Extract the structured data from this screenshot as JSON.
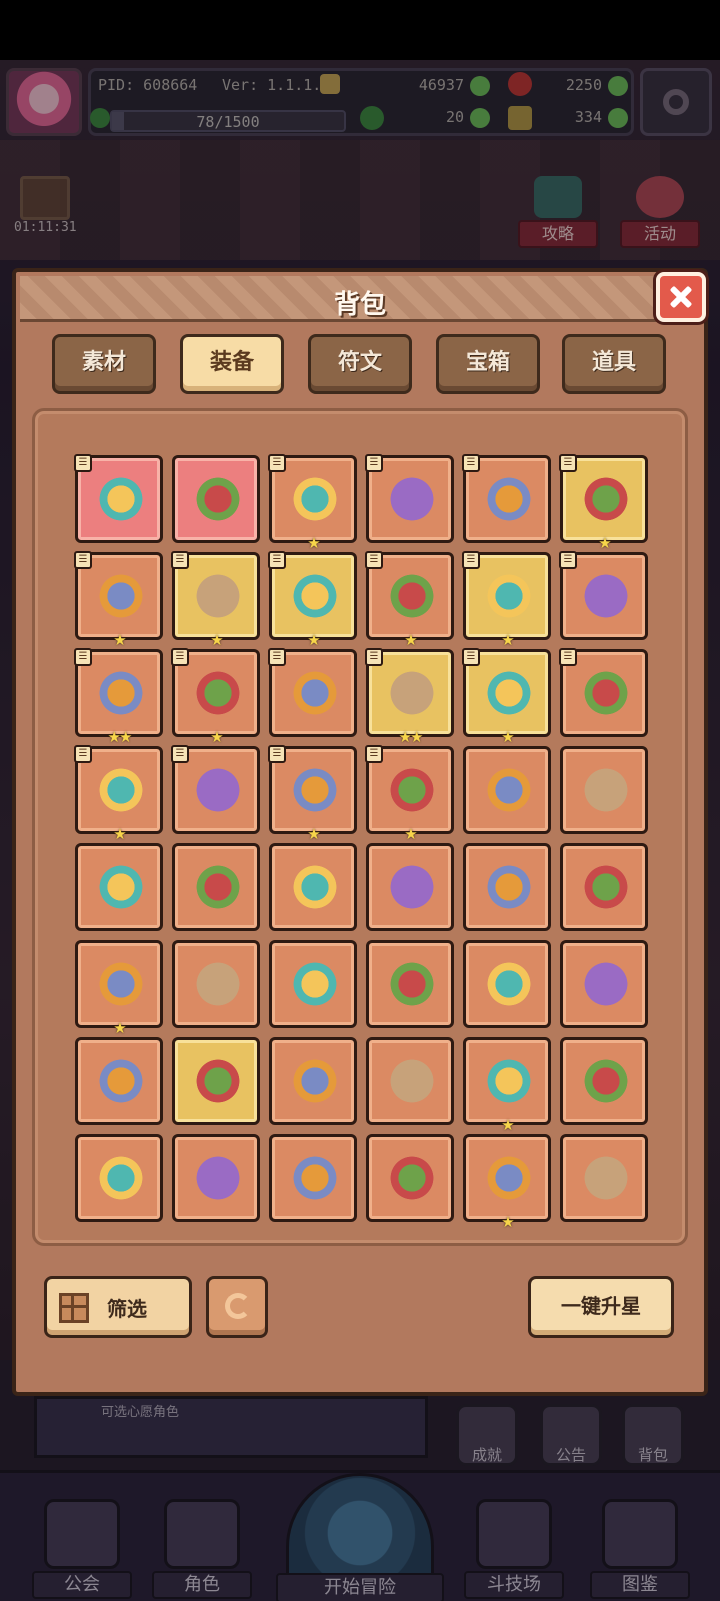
{
  "hud": {
    "pid": "PID: 608664",
    "version": "Ver: 1.1.1.4",
    "xp": "78/1500",
    "xp_fraction": 0.052,
    "currency_green": "46937",
    "currency_red": "2250",
    "clover": "20",
    "keys": "334",
    "timer": "01:11:31",
    "guide_label": "攻略",
    "event_label": "活动"
  },
  "modal": {
    "title": "背包",
    "tabs": [
      {
        "label": "素材",
        "active": false
      },
      {
        "label": "装备",
        "active": true
      },
      {
        "label": "符文",
        "active": false
      },
      {
        "label": "宝箱",
        "active": false
      },
      {
        "label": "道具",
        "active": false
      }
    ],
    "filter_label": "筛选",
    "upgrade_label": "一键升星"
  },
  "items": [
    {
      "icon": "ring-icon",
      "bg": "pink",
      "tag": true,
      "stars": 0
    },
    {
      "icon": "staff-icon",
      "bg": "pink",
      "tag": false,
      "stars": 0
    },
    {
      "icon": "mace-icon",
      "bg": "orange",
      "tag": true,
      "stars": 1
    },
    {
      "icon": "scepter-icon",
      "bg": "orange",
      "tag": true,
      "stars": 0
    },
    {
      "icon": "wand-icon",
      "bg": "orange",
      "tag": true,
      "stars": 0
    },
    {
      "icon": "orb-icon",
      "bg": "gold",
      "tag": true,
      "stars": 1
    },
    {
      "icon": "circlet-icon",
      "bg": "orange",
      "tag": true,
      "stars": 1
    },
    {
      "icon": "crown-icon",
      "bg": "gold",
      "tag": true,
      "stars": 1
    },
    {
      "icon": "armor-icon",
      "bg": "gold",
      "tag": true,
      "stars": 1
    },
    {
      "icon": "bracer-icon",
      "bg": "orange",
      "tag": true,
      "stars": 1
    },
    {
      "icon": "gauntlet-icon",
      "bg": "gold",
      "tag": true,
      "stars": 1
    },
    {
      "icon": "cloak-icon",
      "bg": "orange",
      "tag": true,
      "stars": 0
    },
    {
      "icon": "necklace-icon",
      "bg": "orange",
      "tag": true,
      "stars": 2
    },
    {
      "icon": "belt-icon",
      "bg": "orange",
      "tag": true,
      "stars": 1
    },
    {
      "icon": "teal-belt-icon",
      "bg": "orange",
      "tag": true,
      "stars": 0
    },
    {
      "icon": "boots-icon",
      "bg": "gold",
      "tag": true,
      "stars": 2
    },
    {
      "icon": "greaves-icon",
      "bg": "gold",
      "tag": true,
      "stars": 1
    },
    {
      "icon": "shoes-icon",
      "bg": "orange",
      "tag": true,
      "stars": 0
    },
    {
      "icon": "amulet-icon",
      "bg": "orange",
      "tag": true,
      "stars": 1
    },
    {
      "icon": "gem-icon",
      "bg": "orange",
      "tag": true,
      "stars": 0
    },
    {
      "icon": "pendant-icon",
      "bg": "orange",
      "tag": true,
      "stars": 1
    },
    {
      "icon": "gold-ring-icon",
      "bg": "orange",
      "tag": true,
      "stars": 1
    },
    {
      "icon": "scythe-icon",
      "bg": "orange",
      "tag": false,
      "stars": 0
    },
    {
      "icon": "crystal-staff-icon",
      "bg": "orange",
      "tag": false,
      "stars": 0
    },
    {
      "icon": "sword-icon",
      "bg": "orange",
      "tag": false,
      "stars": 0
    },
    {
      "icon": "helmet-icon",
      "bg": "orange",
      "tag": false,
      "stars": 0
    },
    {
      "icon": "horned-helmet-icon",
      "bg": "orange",
      "tag": false,
      "stars": 0
    },
    {
      "icon": "green-belt-icon",
      "bg": "orange",
      "tag": false,
      "stars": 0
    },
    {
      "icon": "hood-icon",
      "bg": "orange",
      "tag": false,
      "stars": 0
    },
    {
      "icon": "ice-helmet-icon",
      "bg": "orange",
      "tag": false,
      "stars": 0
    },
    {
      "icon": "gold-vest-icon",
      "bg": "orange",
      "tag": false,
      "stars": 1
    },
    {
      "icon": "chainmail-icon",
      "bg": "orange",
      "tag": false,
      "stars": 0
    },
    {
      "icon": "leaf-armor-icon",
      "bg": "orange",
      "tag": false,
      "stars": 0
    },
    {
      "icon": "blue-cape-icon",
      "bg": "orange",
      "tag": false,
      "stars": 0
    },
    {
      "icon": "dark-glove-icon",
      "bg": "orange",
      "tag": false,
      "stars": 0
    },
    {
      "icon": "flower-glove-icon",
      "bg": "orange",
      "tag": false,
      "stars": 0
    },
    {
      "icon": "gold-bracer-icon",
      "bg": "orange",
      "tag": false,
      "stars": 0
    },
    {
      "icon": "scroll-icon",
      "bg": "gold",
      "tag": false,
      "stars": 0
    },
    {
      "icon": "iron-glove-icon",
      "bg": "orange",
      "tag": false,
      "stars": 0
    },
    {
      "icon": "feather-mask-icon",
      "bg": "orange",
      "tag": false,
      "stars": 0
    },
    {
      "icon": "jewel-ring-icon",
      "bg": "orange",
      "tag": false,
      "stars": 1
    },
    {
      "icon": "dark-ring-icon",
      "bg": "orange",
      "tag": false,
      "stars": 0
    },
    {
      "icon": "olive-belt-icon",
      "bg": "orange",
      "tag": false,
      "stars": 0
    },
    {
      "icon": "green-boots-icon",
      "bg": "orange",
      "tag": false,
      "stars": 0
    },
    {
      "icon": "brown-boots-icon",
      "bg": "orange",
      "tag": false,
      "stars": 0
    },
    {
      "icon": "purple-boots-icon",
      "bg": "orange",
      "tag": false,
      "stars": 0
    },
    {
      "icon": "heart-charm-icon",
      "bg": "orange",
      "tag": false,
      "stars": 1
    },
    {
      "icon": "star-medal-icon",
      "bg": "orange",
      "tag": false,
      "stars": 0
    }
  ],
  "under_panel": {
    "text": "可选心愿角色"
  },
  "side_mini": [
    {
      "label": "成就",
      "icon": "trophy-icon"
    },
    {
      "label": "公告",
      "icon": "megaphone-icon"
    },
    {
      "label": "背包",
      "icon": "bag-icon"
    }
  ],
  "nav": {
    "guild": "公会",
    "character": "角色",
    "adventure": "开始冒险",
    "arena": "斗技场",
    "codex": "图鉴"
  },
  "colors": {
    "accent_gold": "#e8c261",
    "cell_orange": "#db8a63",
    "cell_pink": "#ec7f7f",
    "close_red": "#e35a4b"
  }
}
